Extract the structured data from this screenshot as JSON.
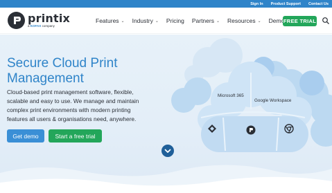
{
  "topbar": {
    "links": [
      "Sign In",
      "Product Support",
      "Contact Us"
    ],
    "color": "#2f84c9"
  },
  "logo": {
    "name": "printix",
    "sub_prefix": "a",
    "sub_brand": "KOFAX",
    "sub_suffix": "company"
  },
  "nav": {
    "items": [
      {
        "label": "Features",
        "has_dropdown": true
      },
      {
        "label": "Industry",
        "has_dropdown": true
      },
      {
        "label": "Pricing",
        "has_dropdown": false
      },
      {
        "label": "Partners",
        "has_dropdown": true
      },
      {
        "label": "Resources",
        "has_dropdown": true
      },
      {
        "label": "Demo",
        "has_dropdown": false
      }
    ],
    "cta_label": "FREE TRIAL",
    "search_icon": "search-icon"
  },
  "hero": {
    "title": "Secure Cloud Print Management",
    "text": "Cloud-based print management software, flexible, scalable and easy to use. We manage and maintain complex print environments with modern printing features all users & organisations need, anywhere.",
    "primary_button": "Get demo",
    "secondary_button": "Start a free trial",
    "cloud_labels": [
      "Microsoft 365",
      "Google Workspace"
    ],
    "cloud_icons": [
      "azure-icon",
      "printix-icon",
      "chrome-icon"
    ],
    "scroll_icon": "chevron-down-icon"
  },
  "colors": {
    "brand_blue": "#2f84c9",
    "green": "#23a65a",
    "dark": "#2b2f36",
    "scroll_button": "#1f5f99"
  }
}
